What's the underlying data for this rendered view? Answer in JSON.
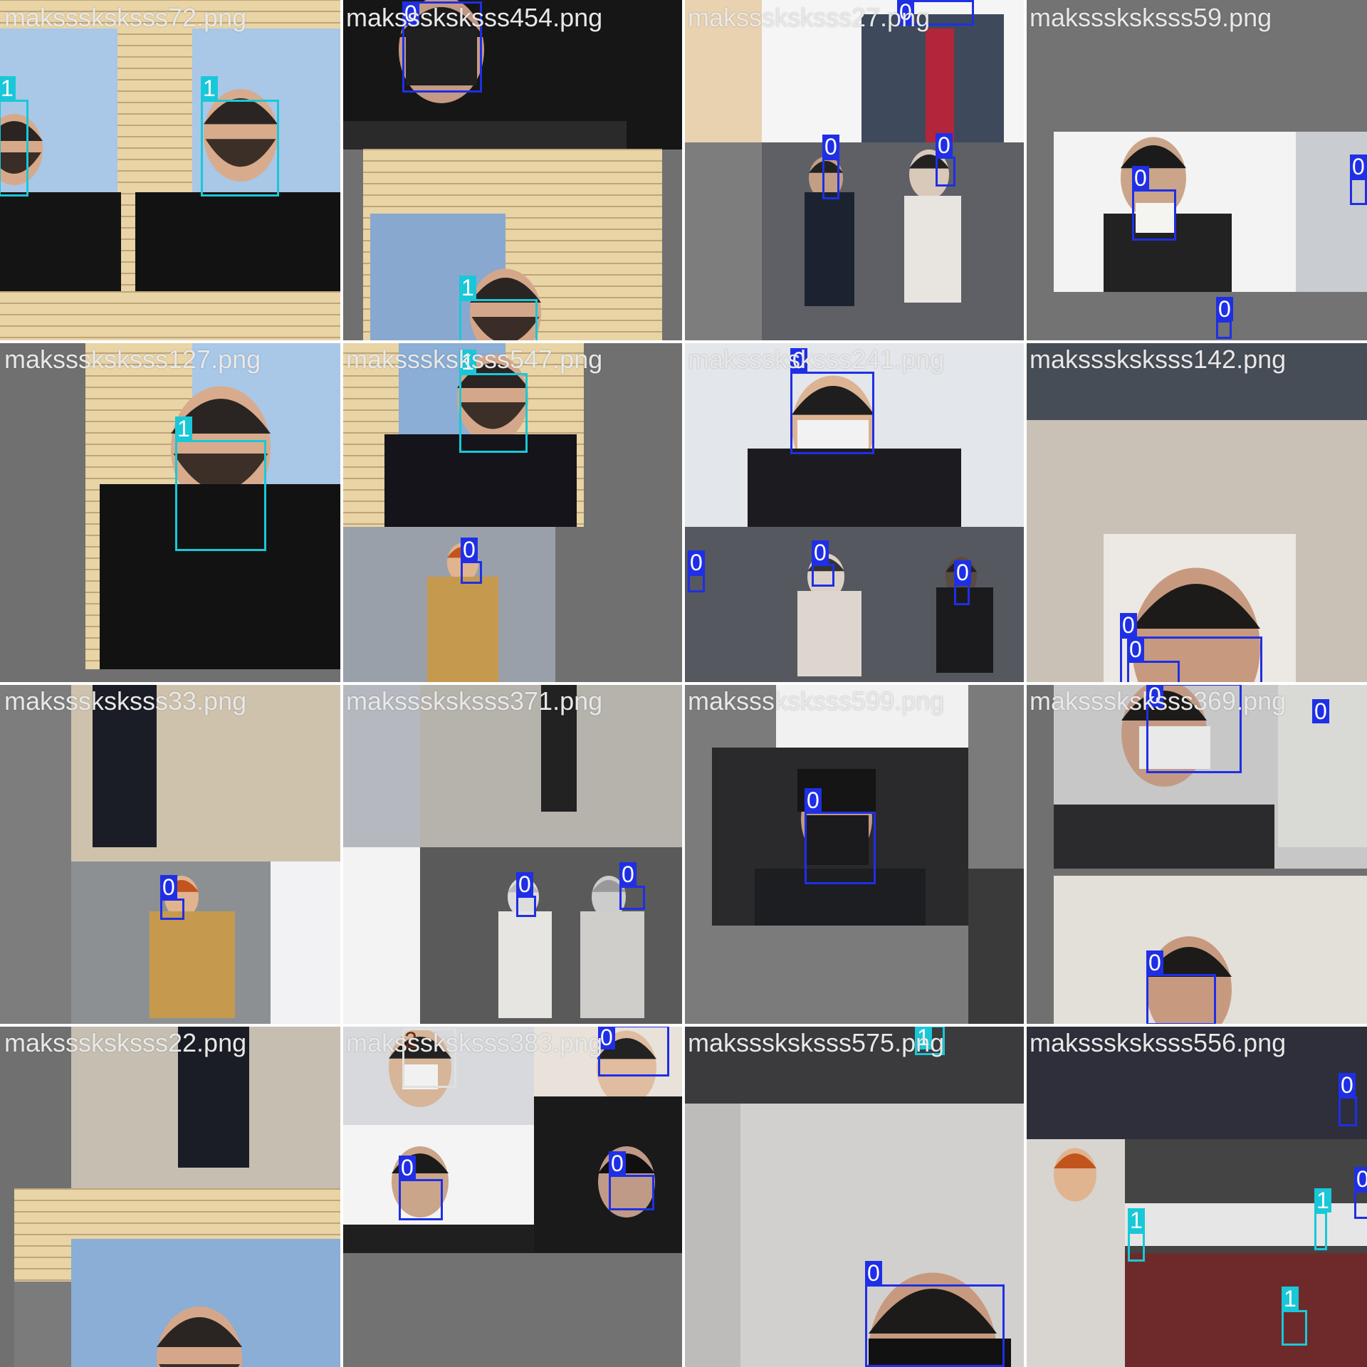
{
  "class_colors": {
    "0": "#1f2fe6",
    "1": "#19c8d8",
    "2": "#e0e0e0"
  },
  "tiles": [
    {
      "filename": "maksssksksss72.png",
      "boxes": [
        {
          "label": "1"
        },
        {
          "label": "1"
        }
      ]
    },
    {
      "filename": "maksssksksss454.png",
      "boxes": [
        {
          "label": "0"
        },
        {
          "label": "1"
        }
      ]
    },
    {
      "filename": "maksssksksss27.png",
      "boxes": [
        {
          "label": "0"
        },
        {
          "label": "0"
        },
        {
          "label": "0"
        }
      ]
    },
    {
      "filename": "maksssksksss59.png",
      "boxes": [
        {
          "label": "0"
        },
        {
          "label": "0"
        },
        {
          "label": "0"
        }
      ]
    },
    {
      "filename": "maksssksksss127.png",
      "boxes": [
        {
          "label": "1"
        }
      ]
    },
    {
      "filename": "maksssksksss547.png",
      "boxes": [
        {
          "label": "1"
        },
        {
          "label": "0"
        }
      ]
    },
    {
      "filename": "maksssksksss241.png",
      "boxes": [
        {
          "label": "0"
        },
        {
          "label": "0"
        },
        {
          "label": "0"
        },
        {
          "label": "0"
        }
      ]
    },
    {
      "filename": "maksssksksss142.png",
      "boxes": [
        {
          "label": "0"
        },
        {
          "label": "0"
        }
      ]
    },
    {
      "filename": "maksssksksss33.png",
      "boxes": [
        {
          "label": "0"
        }
      ]
    },
    {
      "filename": "maksssksksss371.png",
      "boxes": [
        {
          "label": "0"
        },
        {
          "label": "0"
        }
      ]
    },
    {
      "filename": "maksssksksss599.png",
      "boxes": [
        {
          "label": "0"
        }
      ]
    },
    {
      "filename": "maksssksksss369.png",
      "boxes": [
        {
          "label": "0"
        },
        {
          "label": "0"
        },
        {
          "label": "0"
        }
      ]
    },
    {
      "filename": "maksssksksss22.png",
      "boxes": []
    },
    {
      "filename": "maksssksksss383.png",
      "boxes": [
        {
          "label": "2"
        },
        {
          "label": "0"
        },
        {
          "label": "0"
        },
        {
          "label": "0"
        }
      ]
    },
    {
      "filename": "maksssksksss575.png",
      "boxes": [
        {
          "label": "1"
        },
        {
          "label": "0"
        }
      ]
    },
    {
      "filename": "maksssksksss556.png",
      "boxes": [
        {
          "label": "0"
        },
        {
          "label": "0"
        },
        {
          "label": "1"
        },
        {
          "label": "1"
        },
        {
          "label": "1"
        }
      ]
    }
  ]
}
